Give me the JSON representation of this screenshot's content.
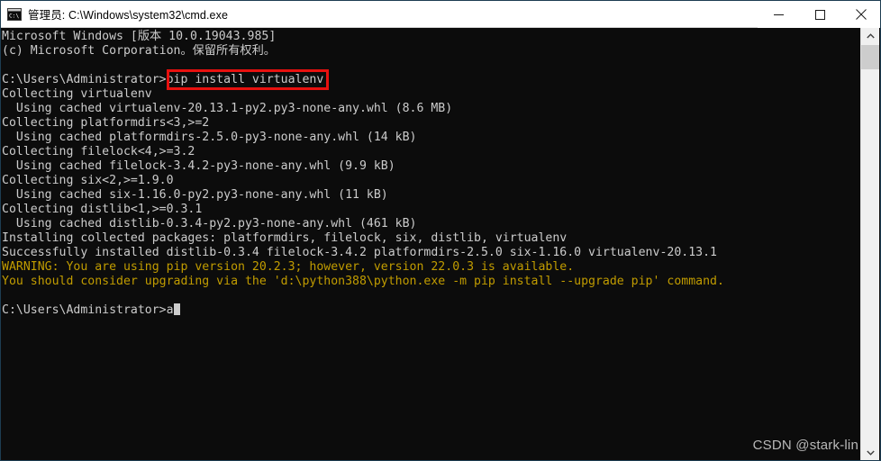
{
  "window": {
    "title": "管理员: C:\\Windows\\system32\\cmd.exe",
    "icon_name": "cmd-console-icon",
    "minimize_label": "最小化",
    "maximize_label": "最大化",
    "close_label": "关闭",
    "background_color": "#0c0c0c",
    "text_color": "#cccccc",
    "warning_color": "#c19c00",
    "border_color": "#1d3d52",
    "annotation_color": "#e8110f"
  },
  "console": {
    "lines": [
      {
        "text": "Microsoft Windows [版本 10.0.19043.985]",
        "color": "white"
      },
      {
        "text": "(c) Microsoft Corporation。保留所有权利。",
        "color": "white"
      },
      {
        "text": "",
        "color": "white"
      },
      {
        "text": "C:\\Users\\Administrator>pip install virtualenv",
        "color": "white"
      },
      {
        "text": "Collecting virtualenv",
        "color": "white"
      },
      {
        "text": "  Using cached virtualenv-20.13.1-py2.py3-none-any.whl (8.6 MB)",
        "color": "white"
      },
      {
        "text": "Collecting platformdirs<3,>=2",
        "color": "white"
      },
      {
        "text": "  Using cached platformdirs-2.5.0-py3-none-any.whl (14 kB)",
        "color": "white"
      },
      {
        "text": "Collecting filelock<4,>=3.2",
        "color": "white"
      },
      {
        "text": "  Using cached filelock-3.4.2-py3-none-any.whl (9.9 kB)",
        "color": "white"
      },
      {
        "text": "Collecting six<2,>=1.9.0",
        "color": "white"
      },
      {
        "text": "  Using cached six-1.16.0-py2.py3-none-any.whl (11 kB)",
        "color": "white"
      },
      {
        "text": "Collecting distlib<1,>=0.3.1",
        "color": "white"
      },
      {
        "text": "  Using cached distlib-0.3.4-py2.py3-none-any.whl (461 kB)",
        "color": "white"
      },
      {
        "text": "Installing collected packages: platformdirs, filelock, six, distlib, virtualenv",
        "color": "white"
      },
      {
        "text": "Successfully installed distlib-0.3.4 filelock-3.4.2 platformdirs-2.5.0 six-1.16.0 virtualenv-20.13.1",
        "color": "white"
      },
      {
        "text": "WARNING: You are using pip version 20.2.3; however, version 22.0.3 is available.",
        "color": "yellow"
      },
      {
        "text": "You should consider upgrading via the 'd:\\python388\\python.exe -m pip install --upgrade pip' command.",
        "color": "yellow"
      },
      {
        "text": "",
        "color": "white"
      },
      {
        "text": "C:\\Users\\Administrator>a",
        "color": "white",
        "cursor": true
      }
    ],
    "command_highlighted": "pip install virtualenv",
    "prompt": "C:\\Users\\Administrator>",
    "current_input": "a"
  },
  "scrollbar": {
    "up_arrow": "▲",
    "down_arrow": "▼"
  },
  "watermark": {
    "text": "CSDN @stark-lin"
  }
}
